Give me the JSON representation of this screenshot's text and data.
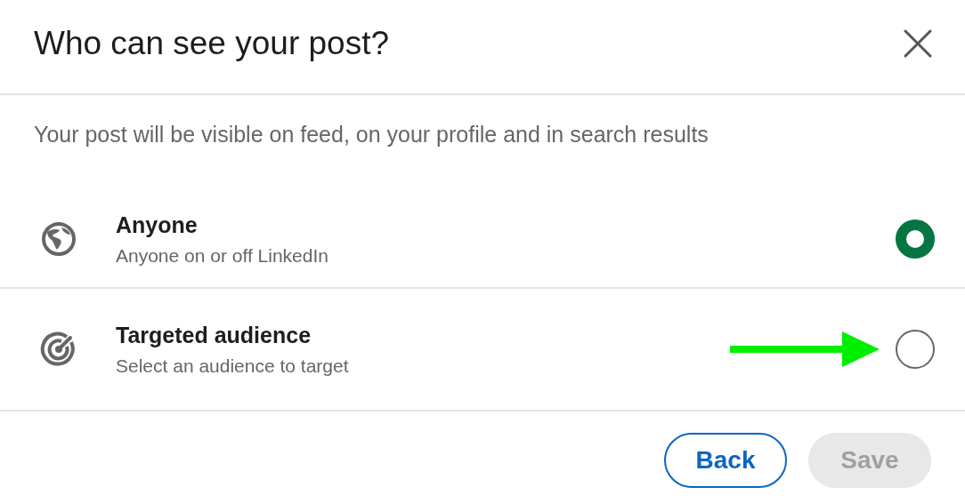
{
  "dialog": {
    "title": "Who can see your post?"
  },
  "description": "Your post will be visible on feed, on your profile and in search results",
  "options": [
    {
      "kind": "globe",
      "label": "Anyone",
      "sublabel": "Anyone on or off LinkedIn",
      "selected": true,
      "arrow": false
    },
    {
      "kind": "target",
      "label": "Targeted audience",
      "sublabel": "Select an audience to target",
      "selected": false,
      "arrow": true
    }
  ],
  "buttons": [
    {
      "label": "Back",
      "disabled": false
    },
    {
      "label": "Save",
      "disabled": true
    }
  ]
}
